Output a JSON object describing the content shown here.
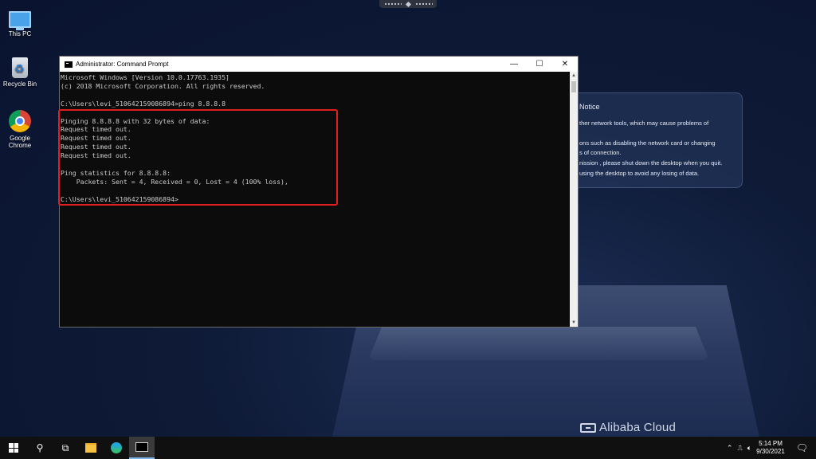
{
  "desktop": {
    "icons": [
      {
        "label": "This PC"
      },
      {
        "label": "Recycle Bin"
      },
      {
        "label": "Google Chrome"
      }
    ]
  },
  "notice": {
    "title": "Notice",
    "lines": [
      "ther network tools, which may cause  problems of",
      "ons such as disabling the network card  or changing",
      "s of connection.",
      "nission , please shut down the desktop when you quit.",
      "using the desktop to avoid any losing of data."
    ]
  },
  "brand": {
    "text": "Alibaba Cloud"
  },
  "cmd": {
    "title": "Administrator: Command Prompt",
    "controls": {
      "minimize": "—",
      "maximize": "☐",
      "close": "✕"
    },
    "output": "Microsoft Windows [Version 10.0.17763.1935]\n(c) 2018 Microsoft Corporation. All rights reserved.\n\nC:\\Users\\levi_510642159086894>ping 8.8.8.8\n\nPinging 8.8.8.8 with 32 bytes of data:\nRequest timed out.\nRequest timed out.\nRequest timed out.\nRequest timed out.\n\nPing statistics for 8.8.8.8:\n    Packets: Sent = 4, Received = 0, Lost = 4 (100% loss),\n\nC:\\Users\\levi_510642159086894>"
  },
  "taskbar": {
    "time": "5:14 PM",
    "date": "9/30/2021"
  },
  "colors": {
    "highlight": "#e02020",
    "console_bg": "#0c0c0c",
    "taskbar_bg": "#101010"
  }
}
